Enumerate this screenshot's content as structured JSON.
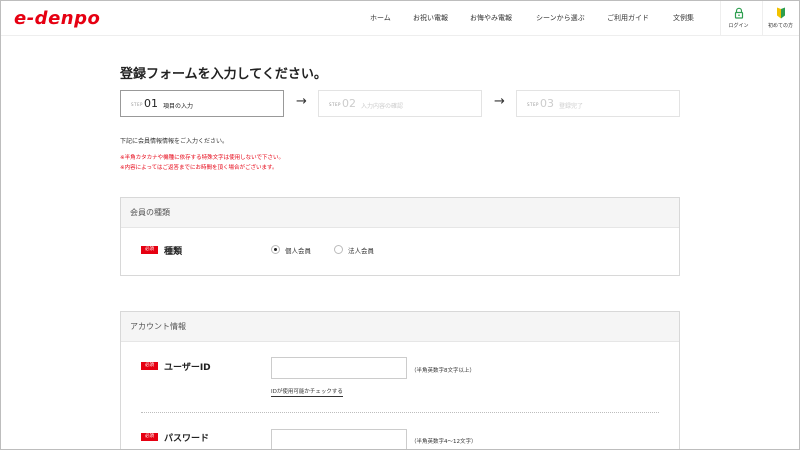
{
  "header": {
    "logo": "e-denpo",
    "nav": [
      "ホーム",
      "お祝い電報",
      "お悔やみ電報",
      "シーンから選ぶ",
      "ご利用ガイド",
      "文例集"
    ],
    "login_label": "ログイン",
    "beginner_label": "初めての方",
    "accent_color": "#e60012"
  },
  "page": {
    "title": "登録フォームを入力してください。"
  },
  "steps": [
    {
      "label": "STEP",
      "number": "01",
      "title": "項目の入力",
      "active": true
    },
    {
      "label": "STEP",
      "number": "02",
      "title": "入力内容の確認",
      "active": false
    },
    {
      "label": "STEP",
      "number": "03",
      "title": "登録完了",
      "active": false
    }
  ],
  "notes": {
    "intro": "下記に会員情報情報をご入力ください。",
    "warnings": [
      "※半角カタカナや機種に依存する特殊文字は使用しないで下さい。",
      "※内容によってはご返答までにお時間を頂く場合がございます。"
    ]
  },
  "section_member": {
    "header": "会員の種類",
    "required": "必須",
    "field_label": "種類",
    "options": [
      {
        "label": "個人会員",
        "checked": true
      },
      {
        "label": "法人会員",
        "checked": false
      }
    ]
  },
  "section_account": {
    "header": "アカウント情報",
    "user_id": {
      "required": "必須",
      "label": "ユーザーID",
      "hint": "（半角英数字8文字以上）",
      "check_link": "IDが使用可能かチェックする"
    },
    "password": {
      "required": "必須",
      "label": "パスワード",
      "hint": "（半角英数字4〜12文字）"
    }
  }
}
